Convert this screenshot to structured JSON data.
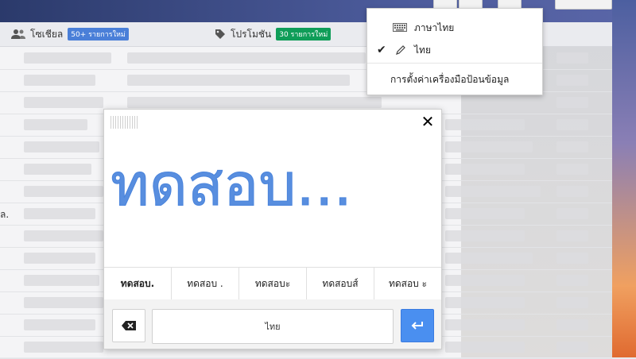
{
  "tabs": {
    "social": {
      "label": "โซเชียล",
      "badge": "50+ รายการใหม่",
      "badge_color": "#4a7fd8"
    },
    "promotions": {
      "label": "โปรโมชัน",
      "badge": "30 รายการใหม่",
      "badge_color": "#0f9d58"
    }
  },
  "left_edge_text": "ล.",
  "input_menu": {
    "items": [
      {
        "label": "ภาษาไทย",
        "icon": "keyboard-icon",
        "checked": false
      },
      {
        "label": "ไทย",
        "icon": "pencil-icon",
        "checked": true
      }
    ],
    "settings_label": "การตั้งค่าเครื่องมือป้อนข้อมูล"
  },
  "handwriting": {
    "written_text": "ทดสอบ...",
    "ink_color": "#4a84dc",
    "candidates": [
      "ทดสอบ.",
      "ทดสอบ .",
      "ทดสอบะ",
      "ทดสอบส์",
      "ทดสอบ ะ"
    ],
    "space_label": "ไทย",
    "accent": "#4a8ff0"
  }
}
